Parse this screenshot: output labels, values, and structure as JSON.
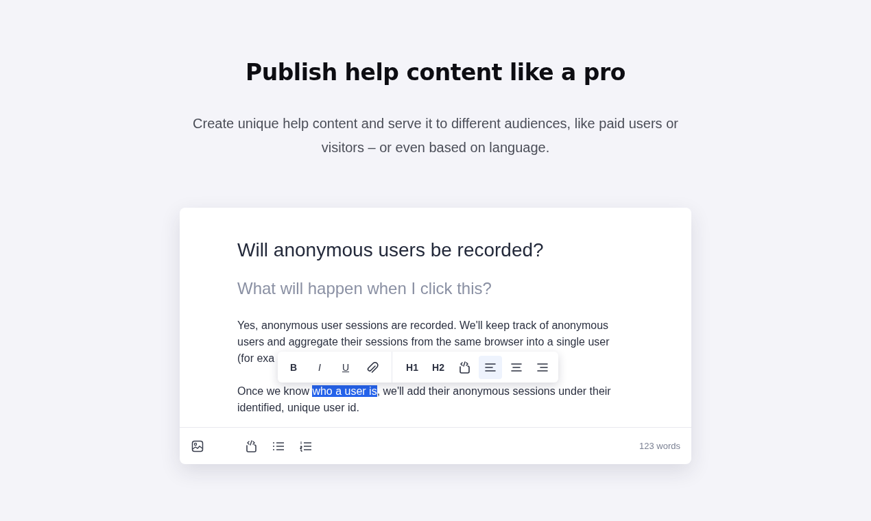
{
  "hero": {
    "title": "Publish help content like a pro",
    "subtitle": "Create unique help content and serve it to different audiences, like paid users or visitors – or even based on language."
  },
  "editor": {
    "title": "Will anonymous users be recorded?",
    "subtitle": "What will happen when I click this?",
    "paragraph_1": {
      "lines": [
        "Yes, anonymous user sessions are recorded. We'll keep track of anonymous",
        "users and aggregate their sessions from the same browser into a single user",
        "(for exa"
      ]
    },
    "paragraph_2": {
      "text_before": "Once we know ",
      "selected_text": "who a user is",
      "text_after": ", we'll add their anonymous sessions under their identified, unique user id."
    },
    "format_toolbar": [
      {
        "kind": "text",
        "label": "B",
        "selected": false
      },
      {
        "kind": "text",
        "label": "I",
        "selected": false
      },
      {
        "kind": "text",
        "label": "U",
        "selected": false
      },
      {
        "kind": "icon",
        "selected": false
      },
      {
        "kind": "divider"
      },
      {
        "kind": "text",
        "label": "H1",
        "selected": false
      },
      {
        "kind": "text",
        "label": "H2",
        "selected": false
      },
      {
        "kind": "icon",
        "selected": false
      },
      {
        "kind": "icon",
        "selected": true
      },
      {
        "kind": "icon",
        "selected": false
      },
      {
        "kind": "icon",
        "selected": false
      }
    ],
    "footer": {
      "word_count": "123 words"
    }
  }
}
